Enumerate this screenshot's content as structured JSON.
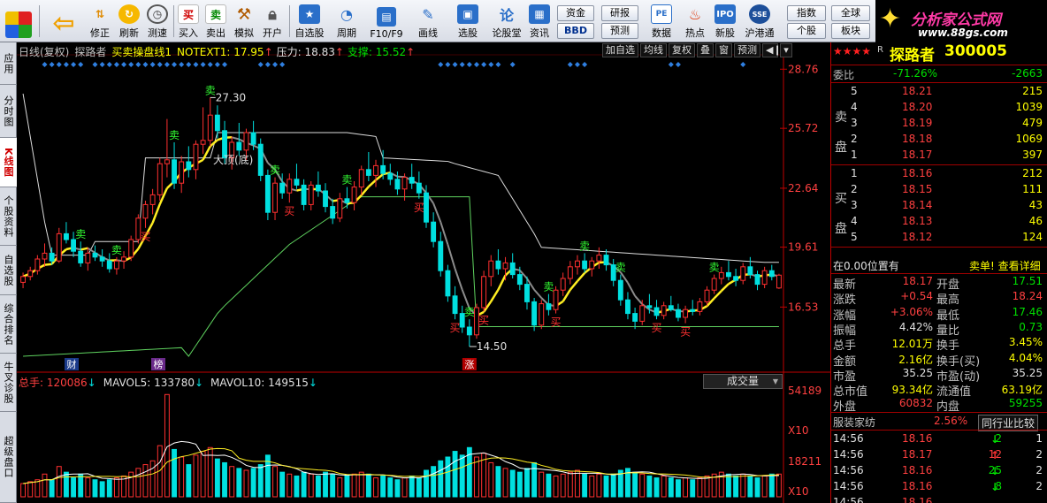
{
  "toolbar": {
    "buttons": [
      "修正",
      "刷新",
      "测速",
      "买入",
      "卖出",
      "模拟",
      "开户",
      "自选股",
      "周期",
      "F10/F9",
      "画线",
      "选股",
      "论股堂",
      "资讯",
      "数据",
      "热点",
      "新股",
      "沪港通"
    ],
    "tags": {
      "zijin": "资金",
      "bbd": "BBD",
      "yanbao": "研报",
      "yuce": "预测",
      "zhishu": "指数",
      "quanqiu": "全球",
      "gegu": "个股",
      "bankuai": "板块"
    },
    "brand_title": "分析家公式网",
    "brand_url": "www.88gs.com"
  },
  "sidebar": [
    {
      "label": "应用",
      "active": false
    },
    {
      "label": "分时图",
      "active": false
    },
    {
      "label": "K线图",
      "active": true
    },
    {
      "label": "个股资料",
      "active": false
    },
    {
      "label": "自选股",
      "active": false
    },
    {
      "label": "综合排名",
      "active": false
    },
    {
      "label": "牛叉诊股",
      "active": false
    },
    {
      "label": "超级盘口",
      "active": false
    }
  ],
  "kinfo": {
    "period": "日线(复权)",
    "stock": "探路者",
    "indicator": "买卖操盘线1",
    "notext_label": "NOTEXT1: 17.95",
    "pressure": "压力: 18.83",
    "support": "支撑: 15.52"
  },
  "chart_buttons": [
    "加自选",
    "均线",
    "复权",
    "叠",
    "窗",
    "预测"
  ],
  "chart_text": {
    "high_label": "27.30",
    "low_label": "14.50",
    "top_bottom": "大顶(底)",
    "buy": "买",
    "sell": "卖",
    "cai": "财",
    "bang": "榜",
    "zhang": "涨"
  },
  "price_axis": [
    "28.76",
    "25.72",
    "22.64",
    "19.61",
    "16.53"
  ],
  "volinfo": {
    "total": "总手: 120086",
    "mavol5": "MAVOL5: 133780",
    "mavol10": "MAVOL10: 149515"
  },
  "vol_dropdown": "成交量",
  "vol_axis": {
    "top": "54189",
    "x10a": "X10",
    "mid": "18211",
    "x10b": "X10"
  },
  "panel": {
    "stars": "★★★★",
    "r": "R",
    "name": "探路者",
    "code": "300005",
    "weibi_label": "委比",
    "weibi_pct": "-71.26%",
    "weibi_diff": "-2663",
    "sell_side": "卖盘",
    "buy_side": "买盘",
    "sells": [
      {
        "level": "5",
        "price": "18.21",
        "vol": "215"
      },
      {
        "level": "4",
        "price": "18.20",
        "vol": "1039"
      },
      {
        "level": "3",
        "price": "18.19",
        "vol": "479"
      },
      {
        "level": "2",
        "price": "18.18",
        "vol": "1069"
      },
      {
        "level": "1",
        "price": "18.17",
        "vol": "397"
      }
    ],
    "buys": [
      {
        "level": "1",
        "price": "18.16",
        "vol": "212"
      },
      {
        "level": "2",
        "price": "18.15",
        "vol": "111"
      },
      {
        "level": "3",
        "price": "18.14",
        "vol": "43"
      },
      {
        "level": "4",
        "price": "18.13",
        "vol": "46"
      },
      {
        "level": "5",
        "price": "18.12",
        "vol": "124"
      }
    ],
    "position_text": "在0.00位置有",
    "order_link": "卖单! 查看详细",
    "stats": [
      {
        "l1": "最新",
        "v1": "18.17",
        "c1": "red",
        "l2": "开盘",
        "v2": "17.51",
        "c2": "green"
      },
      {
        "l1": "涨跌",
        "v1": "+0.54",
        "c1": "red",
        "l2": "最高",
        "v2": "18.24",
        "c2": "red"
      },
      {
        "l1": "涨幅",
        "v1": "+3.06%",
        "c1": "red",
        "l2": "最低",
        "v2": "17.46",
        "c2": "green"
      },
      {
        "l1": "振幅",
        "v1": "4.42%",
        "c1": "white",
        "l2": "量比",
        "v2": "0.73",
        "c2": "green"
      },
      {
        "l1": "总手",
        "v1": "12.01万",
        "c1": "yellow",
        "l2": "换手",
        "v2": "3.45%",
        "c2": "yellow"
      },
      {
        "l1": "金额",
        "v1": "2.16亿",
        "c1": "yellow",
        "l2": "换手(买)",
        "v2": "4.04%",
        "c2": "yellow"
      },
      {
        "l1": "市盈",
        "v1": "35.25",
        "c1": "white",
        "l2": "市盈(动)",
        "v2": "35.25",
        "c2": "white"
      },
      {
        "l1": "总市值",
        "v1": "93.34亿",
        "c1": "yellow",
        "l2": "流通值",
        "v2": "63.19亿",
        "c2": "yellow"
      },
      {
        "l1": "外盘",
        "v1": "60832",
        "c1": "red",
        "l2": "内盘",
        "v2": "59255",
        "c2": "green"
      }
    ],
    "industry": "服装家纺",
    "industry_pct": "2.56%",
    "compare_btn": "同行业比较",
    "ticks": [
      {
        "time": "14:56",
        "price": "18.16",
        "vol": "2",
        "dir": "down",
        "n": "1"
      },
      {
        "time": "14:56",
        "price": "18.17",
        "vol": "12",
        "dir": "up",
        "n": "2"
      },
      {
        "time": "14:56",
        "price": "18.16",
        "vol": "25",
        "dir": "down",
        "n": "2"
      },
      {
        "time": "14:56",
        "price": "18.16",
        "vol": "8",
        "dir": "down",
        "n": "2"
      },
      {
        "time": "14:56",
        "price": "18.16",
        "vol": "",
        "dir": "down",
        "n": ""
      }
    ]
  },
  "colors": {
    "up": "#ff3030",
    "down": "#00e0e0",
    "ma_yellow": "#ffee22",
    "ma_gray": "#8c8c8c",
    "pressure_line": "#dddddd",
    "support_line": "#5fd35f",
    "accent_red": "#c00000"
  },
  "chart_data": {
    "type": "candlestick",
    "title": "日线(复权) 探路者",
    "ylim": [
      13.5,
      29.5
    ],
    "candles": [
      [
        17.8,
        18.3,
        17.5,
        18.1
      ],
      [
        18.1,
        18.6,
        17.9,
        18.4
      ],
      [
        18.4,
        19.2,
        18.2,
        19.0
      ],
      [
        19.0,
        19.8,
        18.6,
        19.3
      ],
      [
        19.3,
        19.6,
        18.7,
        18.9
      ],
      [
        18.9,
        20.6,
        18.8,
        20.3
      ],
      [
        20.3,
        20.9,
        19.8,
        20.0
      ],
      [
        20.0,
        20.4,
        19.1,
        19.4
      ],
      [
        19.4,
        19.9,
        18.6,
        18.8
      ],
      [
        18.8,
        19.6,
        18.4,
        19.3
      ],
      [
        19.3,
        19.7,
        18.9,
        19.1
      ],
      [
        19.1,
        19.5,
        18.6,
        18.9
      ],
      [
        18.9,
        19.3,
        18.3,
        18.5
      ],
      [
        18.5,
        19.1,
        18.2,
        18.9
      ],
      [
        18.9,
        19.4,
        18.5,
        19.1
      ],
      [
        19.1,
        20.2,
        18.9,
        20.0
      ],
      [
        20.0,
        21.3,
        19.8,
        21.1
      ],
      [
        21.1,
        22.0,
        20.6,
        21.8
      ],
      [
        21.8,
        22.6,
        21.3,
        22.3
      ],
      [
        22.3,
        24.2,
        22.0,
        23.9
      ],
      [
        23.9,
        26.2,
        23.2,
        24.1
      ],
      [
        24.1,
        25.0,
        22.6,
        22.9
      ],
      [
        22.9,
        24.3,
        22.4,
        24.0
      ],
      [
        24.0,
        24.8,
        23.2,
        23.6
      ],
      [
        23.6,
        25.1,
        23.1,
        24.9
      ],
      [
        24.9,
        26.8,
        24.4,
        25.1
      ],
      [
        25.1,
        27.3,
        24.8,
        26.4
      ],
      [
        26.4,
        26.9,
        25.2,
        25.6
      ],
      [
        25.6,
        26.1,
        23.9,
        24.2
      ],
      [
        24.2,
        25.3,
        23.6,
        25.0
      ],
      [
        25.0,
        26.0,
        24.3,
        24.6
      ],
      [
        24.6,
        25.7,
        24.1,
        25.5
      ],
      [
        25.5,
        26.1,
        24.6,
        24.9
      ],
      [
        24.9,
        25.2,
        23.0,
        23.3
      ],
      [
        23.3,
        23.6,
        21.0,
        21.4
      ],
      [
        21.4,
        23.2,
        21.0,
        22.9
      ],
      [
        22.9,
        23.4,
        22.1,
        22.4
      ],
      [
        22.4,
        23.4,
        21.9,
        23.1
      ],
      [
        23.1,
        23.9,
        22.6,
        22.8
      ],
      [
        22.8,
        23.1,
        21.5,
        21.8
      ],
      [
        21.8,
        23.0,
        21.5,
        22.8
      ],
      [
        22.8,
        23.5,
        22.2,
        22.5
      ],
      [
        22.5,
        22.9,
        21.4,
        21.7
      ],
      [
        21.7,
        22.1,
        20.8,
        21.1
      ],
      [
        21.1,
        22.4,
        20.9,
        22.1
      ],
      [
        22.1,
        22.7,
        21.6,
        21.9
      ],
      [
        21.9,
        23.0,
        21.5,
        22.7
      ],
      [
        22.7,
        23.8,
        22.3,
        23.6
      ],
      [
        23.6,
        24.5,
        23.0,
        23.3
      ],
      [
        23.3,
        24.1,
        22.7,
        23.8
      ],
      [
        23.8,
        24.6,
        23.1,
        23.4
      ],
      [
        23.4,
        23.9,
        22.8,
        23.1
      ],
      [
        23.1,
        23.5,
        22.3,
        22.6
      ],
      [
        22.6,
        23.4,
        22.0,
        23.2
      ],
      [
        23.2,
        23.9,
        22.6,
        22.9
      ],
      [
        22.9,
        23.5,
        22.1,
        22.4
      ],
      [
        22.4,
        22.8,
        20.6,
        20.9
      ],
      [
        20.9,
        21.4,
        19.6,
        19.9
      ],
      [
        19.9,
        20.4,
        18.1,
        18.4
      ],
      [
        18.4,
        18.7,
        16.8,
        17.1
      ],
      [
        17.1,
        17.6,
        15.9,
        16.2
      ],
      [
        16.2,
        16.6,
        15.2,
        15.5
      ],
      [
        15.5,
        15.9,
        14.5,
        15.1
      ],
      [
        15.1,
        16.7,
        14.9,
        16.5
      ],
      [
        16.5,
        18.4,
        16.3,
        18.1
      ],
      [
        18.1,
        19.2,
        17.6,
        18.9
      ],
      [
        18.9,
        19.5,
        18.2,
        18.5
      ],
      [
        18.5,
        19.1,
        17.9,
        18.8
      ],
      [
        18.8,
        19.3,
        18.0,
        18.2
      ],
      [
        18.2,
        18.6,
        17.4,
        17.7
      ],
      [
        17.7,
        18.1,
        16.4,
        16.8
      ],
      [
        16.8,
        17.0,
        15.3,
        15.6
      ],
      [
        15.6,
        16.9,
        15.4,
        16.7
      ],
      [
        16.7,
        17.2,
        16.1,
        16.4
      ],
      [
        16.4,
        17.6,
        16.2,
        17.4
      ],
      [
        17.4,
        18.3,
        17.1,
        18.0
      ],
      [
        18.0,
        18.9,
        17.7,
        18.6
      ],
      [
        18.6,
        19.2,
        18.2,
        18.9
      ],
      [
        18.9,
        19.3,
        18.3,
        18.5
      ],
      [
        18.5,
        19.1,
        18.1,
        18.9
      ],
      [
        18.9,
        19.6,
        18.5,
        19.2
      ],
      [
        19.2,
        19.5,
        18.4,
        18.7
      ],
      [
        18.7,
        19.0,
        17.6,
        17.9
      ],
      [
        17.9,
        18.2,
        16.6,
        16.9
      ],
      [
        16.9,
        17.3,
        15.9,
        16.2
      ],
      [
        16.2,
        16.5,
        15.4,
        15.8
      ],
      [
        15.8,
        16.9,
        15.6,
        16.6
      ],
      [
        16.6,
        17.2,
        16.2,
        16.5
      ],
      [
        16.5,
        16.9,
        15.9,
        16.1
      ],
      [
        16.1,
        16.8,
        15.9,
        16.6
      ],
      [
        16.6,
        17.1,
        16.3,
        16.4
      ],
      [
        16.4,
        16.7,
        15.8,
        16.0
      ],
      [
        16.0,
        16.6,
        15.7,
        16.4
      ],
      [
        16.4,
        16.9,
        16.1,
        16.3
      ],
      [
        16.3,
        17.0,
        16.1,
        16.8
      ],
      [
        16.8,
        17.6,
        16.6,
        17.4
      ],
      [
        17.4,
        18.2,
        17.2,
        18.0
      ],
      [
        18.0,
        18.6,
        17.7,
        18.3
      ],
      [
        18.3,
        18.9,
        17.9,
        18.1
      ],
      [
        18.1,
        18.5,
        17.6,
        17.9
      ],
      [
        17.9,
        18.8,
        17.7,
        18.6
      ],
      [
        18.6,
        19.1,
        18.0,
        18.2
      ],
      [
        18.2,
        18.4,
        17.4,
        17.7
      ],
      [
        17.7,
        18.6,
        17.5,
        18.4
      ],
      [
        18.4,
        18.7,
        17.9,
        18.1
      ],
      [
        17.51,
        18.24,
        17.46,
        18.17
      ]
    ],
    "volumes": [
      7,
      8,
      9,
      12,
      9,
      16,
      13,
      10,
      12,
      10,
      9,
      8,
      9,
      10,
      11,
      13,
      15,
      17,
      19,
      27,
      54,
      25,
      21,
      17,
      22,
      24,
      26,
      20,
      18,
      16,
      15,
      14,
      15,
      17,
      22,
      16,
      13,
      12,
      11,
      13,
      12,
      11,
      13,
      12,
      10,
      11,
      12,
      13,
      12,
      10,
      11,
      10,
      9,
      10,
      11,
      10,
      14,
      16,
      19,
      21,
      24,
      22,
      26,
      21,
      23,
      18,
      16,
      15,
      14,
      13,
      15,
      18,
      13,
      12,
      11,
      12,
      13,
      14,
      12,
      11,
      12,
      11,
      12,
      14,
      15,
      13,
      12,
      11,
      10,
      11,
      10,
      9,
      10,
      9,
      10,
      11,
      12,
      13,
      12,
      11,
      12,
      11,
      10,
      11,
      12,
      12
    ],
    "vol_ylim": [
      0,
      56
    ],
    "price_axis_ticks": [
      28.76,
      25.72,
      22.64,
      19.61,
      16.53
    ],
    "pressure": 18.83,
    "support": 15.52
  }
}
